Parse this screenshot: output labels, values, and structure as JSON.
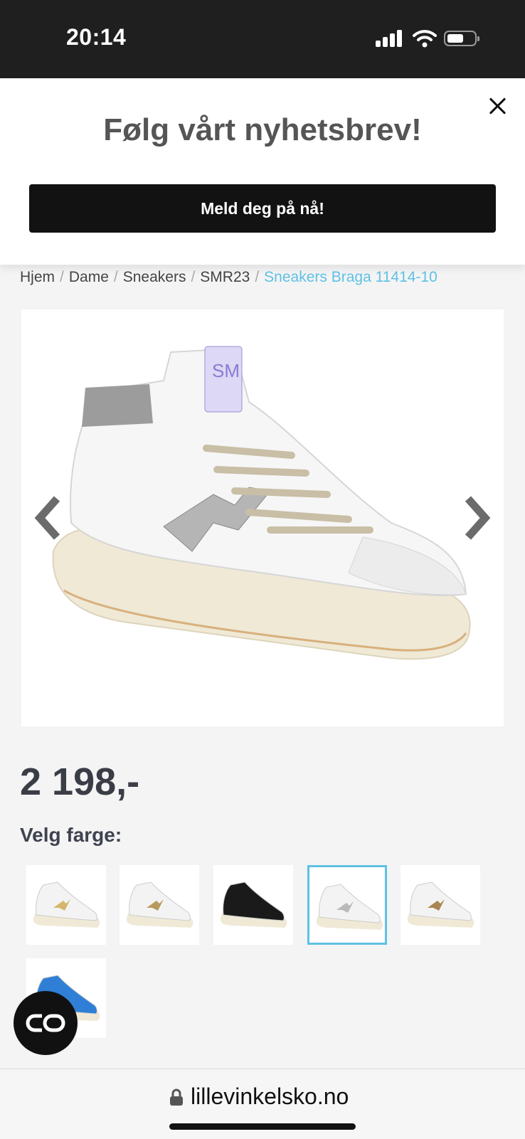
{
  "status_bar": {
    "time": "20:14"
  },
  "newsletter": {
    "title": "Følg vårt nyhetsbrev!",
    "button_label": "Meld deg på nå!"
  },
  "breadcrumb": [
    {
      "label": "Hjem"
    },
    {
      "label": "Dame"
    },
    {
      "label": "Sneakers"
    },
    {
      "label": "SMR23"
    },
    {
      "label": "Sneakers Braga 11414-10"
    }
  ],
  "product": {
    "price": "2 198,-",
    "color_label": "Velg farge:",
    "selected_color_index": 3,
    "color_options": [
      {
        "name": "gold",
        "accent": "#d4b76a"
      },
      {
        "name": "white-gold-glitter",
        "accent": "#b89a5c"
      },
      {
        "name": "black",
        "accent": "#1a1a1a"
      },
      {
        "name": "white-silver-glitter",
        "accent": "#b9b9b9"
      },
      {
        "name": "white-bronze-glitter",
        "accent": "#a98552"
      },
      {
        "name": "white-blue",
        "accent": "#2f7fd6"
      }
    ]
  },
  "browser": {
    "url": "lillevinkelsko.no"
  },
  "colors": {
    "accent": "#5ec1e3",
    "button": "#121212"
  }
}
